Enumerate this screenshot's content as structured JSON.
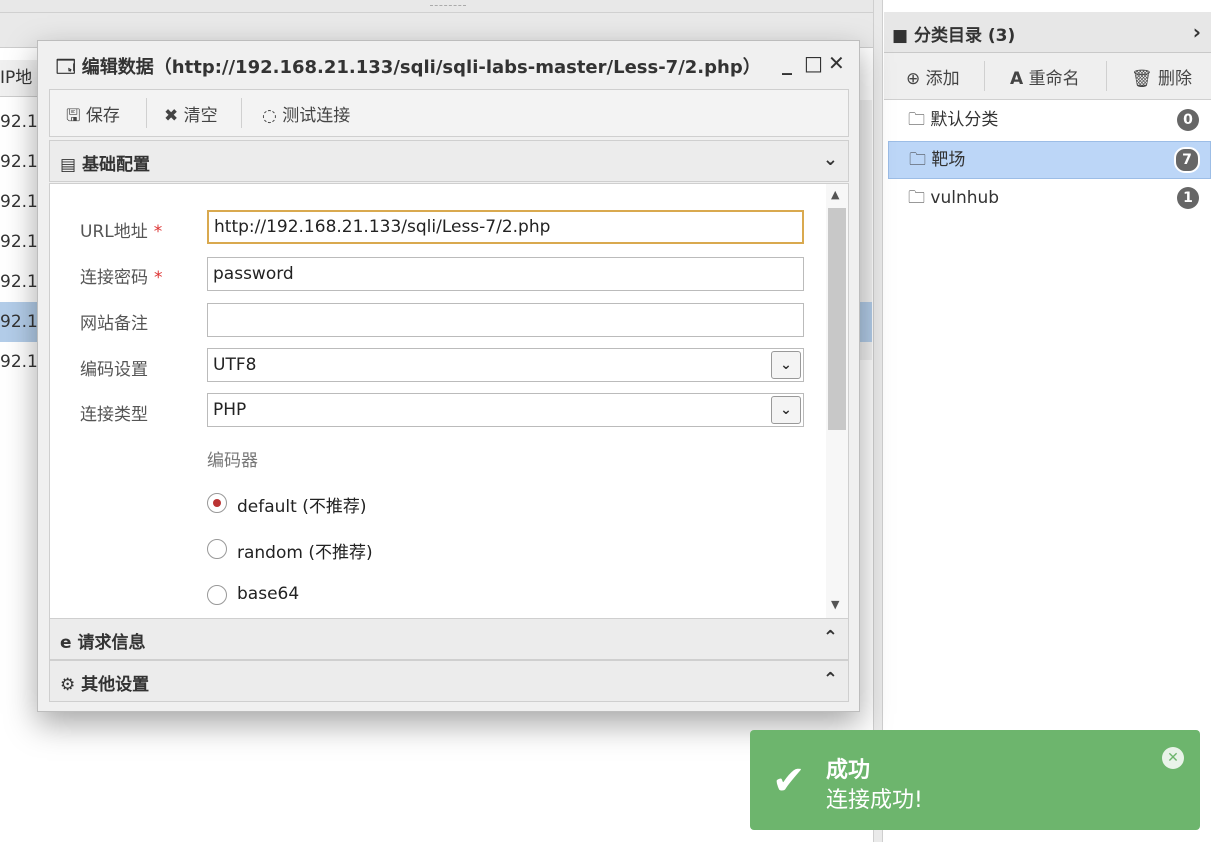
{
  "list": {
    "header": "IP地",
    "rows": [
      "92.1",
      "92.1",
      "92.1",
      "92.1",
      "92.1",
      "92.1",
      "92.1"
    ]
  },
  "right_panel": {
    "title": "分类目录 (3)",
    "toolbar": {
      "add": "添加",
      "rename": "重命名",
      "delete": "删除"
    },
    "categories": [
      {
        "label": "默认分类",
        "count": "0"
      },
      {
        "label": "靶场",
        "count": "7"
      },
      {
        "label": "vulnhub",
        "count": "1"
      }
    ]
  },
  "dialog": {
    "title": "编辑数据（http://192.168.21.133/sqli/sqli-labs-master/Less-7/2.php）",
    "toolbar": {
      "save": "保存",
      "clear": "清空",
      "test": "测试连接"
    },
    "sections": {
      "basic": "基础配置",
      "request": "请求信息",
      "other": "其他设置"
    },
    "fields": {
      "url_label": "URL地址",
      "url_value": "http://192.168.21.133/sqli/Less-7/2.php",
      "password_label": "连接密码",
      "password_value": "password",
      "note_label": "网站备注",
      "note_value": "",
      "encoding_label": "编码设置",
      "encoding_value": "UTF8",
      "type_label": "连接类型",
      "type_value": "PHP",
      "encoder_label": "编码器",
      "required_mark": "*"
    },
    "encoders": [
      {
        "label": "default (不推荐)",
        "selected": true
      },
      {
        "label": "random (不推荐)",
        "selected": false
      },
      {
        "label": "base64",
        "selected": false
      }
    ]
  },
  "toast": {
    "title": "成功",
    "message": "连接成功!",
    "color": "#6db56d"
  }
}
